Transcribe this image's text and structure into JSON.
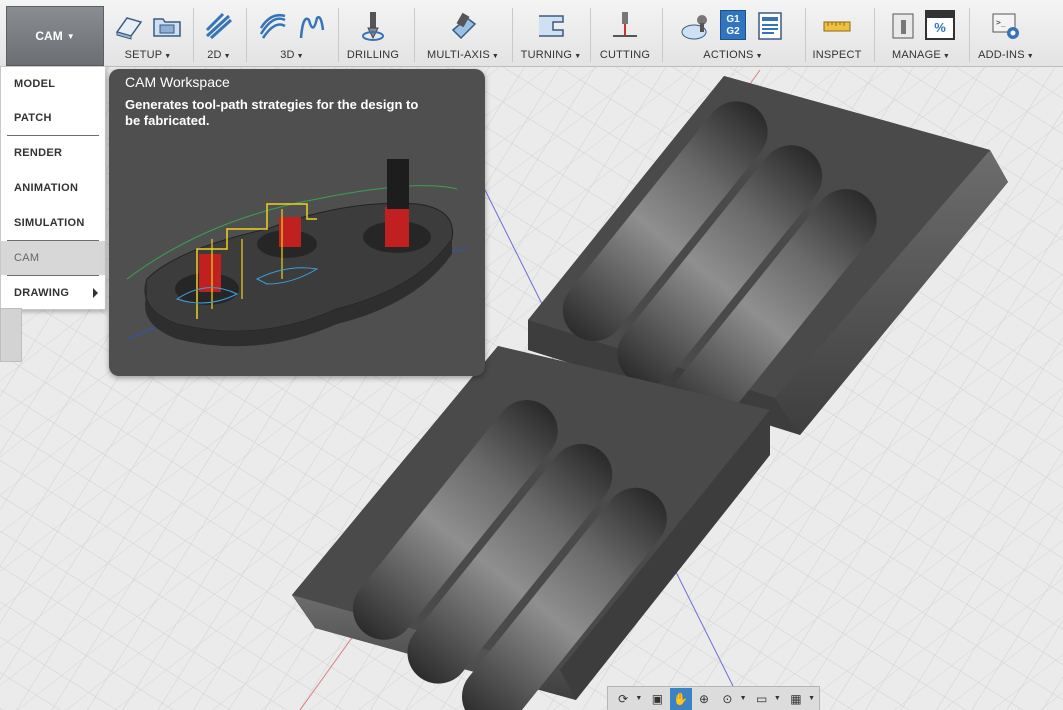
{
  "toolbar": {
    "workspace_label": "CAM",
    "groups": [
      {
        "label": "SETUP",
        "dropdown": true
      },
      {
        "label": "2D",
        "dropdown": true
      },
      {
        "label": "3D",
        "dropdown": true
      },
      {
        "label": "DRILLING",
        "dropdown": false
      },
      {
        "label": "MULTI-AXIS",
        "dropdown": true
      },
      {
        "label": "TURNING",
        "dropdown": true
      },
      {
        "label": "CUTTING",
        "dropdown": false
      },
      {
        "label": "ACTIONS",
        "dropdown": true
      },
      {
        "label": "INSPECT",
        "dropdown": false
      },
      {
        "label": "MANAGE",
        "dropdown": true
      },
      {
        "label": "ADD-INS",
        "dropdown": true
      }
    ],
    "actions_icon_text": [
      "G1",
      "G2"
    ],
    "manage_icon_text": "%"
  },
  "workspace_menu": {
    "items": [
      "MODEL",
      "PATCH",
      "RENDER",
      "ANIMATION",
      "SIMULATION",
      "CAM",
      "DRAWING"
    ],
    "active": "CAM"
  },
  "tooltip": {
    "title": "CAM Workspace",
    "description": "Generates tool-path strategies for the design to be fabricated."
  },
  "colors": {
    "toolbar_bg": "#eaeaea",
    "workspace_btn": "#7a7d82",
    "tooltip_bg": "#4f4f4f",
    "nav_active": "#3c83c6",
    "model_gray": "#5a5a5a"
  }
}
